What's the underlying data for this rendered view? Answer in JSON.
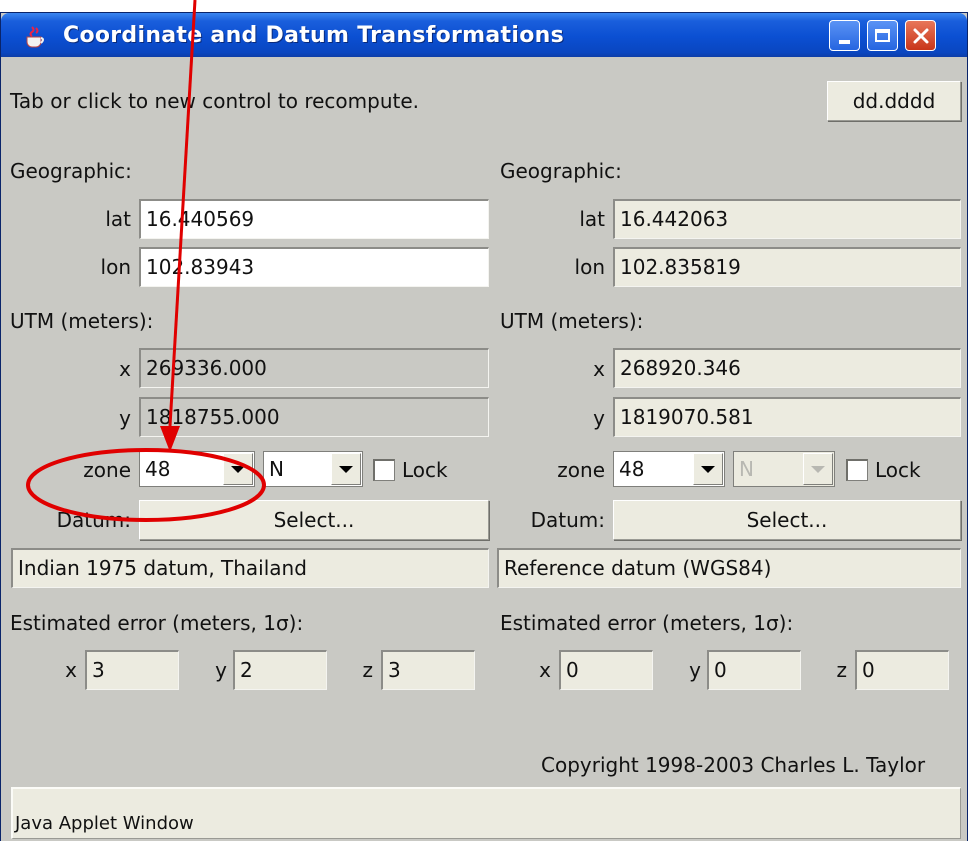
{
  "window": {
    "title": "Coordinate and Datum Transformations"
  },
  "toolbar": {
    "hint": "Tab or click to new control to recompute.",
    "format_button": "dd.dddd"
  },
  "left": {
    "geographic_label": "Geographic:",
    "lat_label": "lat",
    "lat_value": "16.440569",
    "lon_label": "lon",
    "lon_value": "102.83943",
    "utm_label": "UTM (meters):",
    "x_label": "x",
    "x_value": "269336.000",
    "y_label": "y",
    "y_value": "1818755.000",
    "zone_label": "zone",
    "zone_value": "48",
    "hemisphere": "N",
    "lock_label": "Lock",
    "datum_label": "Datum:",
    "select_button": "Select...",
    "datum_name": "Indian 1975 datum, Thailand",
    "error_label": "Estimated error (meters, 1σ):",
    "err_x_label": "x",
    "err_x": "3",
    "err_y_label": "y",
    "err_y": "2",
    "err_z_label": "z",
    "err_z": "3"
  },
  "right": {
    "geographic_label": "Geographic:",
    "lat_label": "lat",
    "lat_value": "16.442063",
    "lon_label": "lon",
    "lon_value": "102.835819",
    "utm_label": "UTM (meters):",
    "x_label": "x",
    "x_value": "268920.346",
    "y_label": "y",
    "y_value": "1819070.581",
    "zone_label": "zone",
    "zone_value": "48",
    "hemisphere": "N",
    "lock_label": "Lock",
    "datum_label": "Datum:",
    "select_button": "Select...",
    "datum_name": "Reference datum (WGS84)",
    "error_label": "Estimated error (meters, 1σ):",
    "err_x_label": "x",
    "err_x": "0",
    "err_y_label": "y",
    "err_y": "0",
    "err_z_label": "z",
    "err_z": "0"
  },
  "footer": {
    "copyright": "Copyright 1998-2003 Charles L. Taylor",
    "status": "Java Applet Window"
  },
  "colors": {
    "titlebar": "#0b4fd2",
    "background": "#c9c9c4",
    "annotation": "#e00000"
  },
  "icons": {
    "app": "java-cup-icon",
    "minimize": "minimize-icon",
    "maximize": "maximize-icon",
    "close": "close-icon"
  }
}
